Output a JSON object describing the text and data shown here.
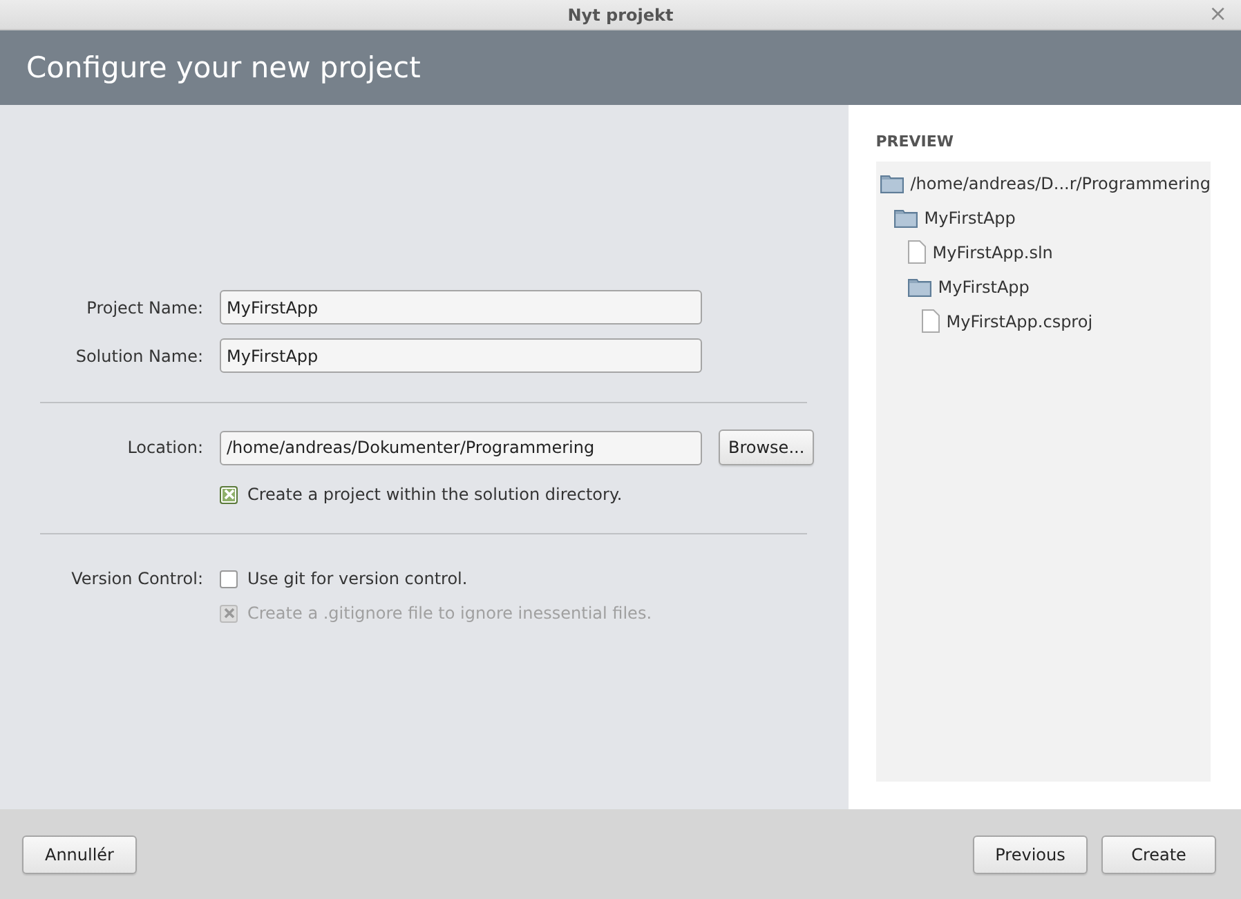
{
  "window": {
    "title": "Nyt projekt",
    "close": "×"
  },
  "header": {
    "title": "Configure your new project"
  },
  "form": {
    "project_name": {
      "label": "Project Name:",
      "value": "MyFirstApp"
    },
    "solution_name": {
      "label": "Solution Name:",
      "value": "MyFirstApp"
    },
    "location": {
      "label": "Location:",
      "value": "/home/andreas/Dokumenter/Programmering",
      "browse": "Browse..."
    },
    "options": [
      {
        "label": "Create a project within the solution directory.",
        "checked": true,
        "disabled": false
      }
    ],
    "version_control": {
      "label": "Version Control:",
      "options": [
        {
          "label": "Use git for version control.",
          "checked": false,
          "disabled": false
        },
        {
          "label": "Create a .gitignore file to ignore inessential files.",
          "checked": true,
          "disabled": true
        }
      ]
    }
  },
  "preview": {
    "title": "PREVIEW",
    "tree": [
      {
        "kind": "folder",
        "name": "/home/andreas/D...r/Programmering",
        "children": [
          {
            "kind": "folder",
            "name": "MyFirstApp",
            "children": [
              {
                "kind": "file",
                "name": "MyFirstApp.sln"
              },
              {
                "kind": "folder",
                "name": "MyFirstApp",
                "children": [
                  {
                    "kind": "file",
                    "name": "MyFirstApp.csproj"
                  }
                ]
              }
            ]
          }
        ]
      }
    ]
  },
  "buttons": {
    "cancel": "Annullér",
    "previous": "Previous",
    "create": "Create"
  }
}
